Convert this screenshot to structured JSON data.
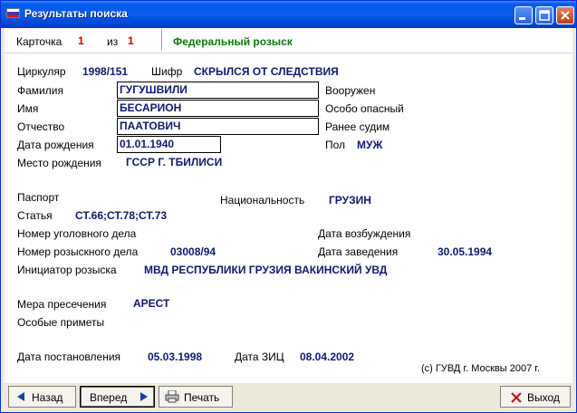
{
  "window": {
    "title": "Результаты поиска"
  },
  "header": {
    "card_label": "Карточка",
    "card_num": "1",
    "of_label": "из",
    "of_num": "1",
    "search_type": "Федеральный розыск"
  },
  "record": {
    "circular_label": "Циркуляр",
    "circular": "1998/151",
    "cipher_label": "Шифр",
    "cipher": "СКРЫЛСЯ ОТ СЛЕДСТВИЯ",
    "surname_label": "Фамилия",
    "surname": "ГУГУШВИЛИ",
    "name_label": "Имя",
    "name": "БЕСАРИОН",
    "patronymic_label": "Отчество",
    "patronymic": "ПААТОВИЧ",
    "birth_date_label": "Дата рождения",
    "birth_date": "01.01.1940",
    "birth_place_label": "Место рождения",
    "birth_place": "ГССР Г. ТБИЛИСИ",
    "armed_label": "Вооружен",
    "dangerous_label": "Особо опасный",
    "convicted_label": "Ранее судим",
    "sex_label": "Пол",
    "sex": "МУЖ",
    "passport_label": "Паспорт",
    "nationality_label": "Национальность",
    "nationality": "ГРУЗИН",
    "article_label": "Статья",
    "article": "СТ.66;СТ.78;СТ.73",
    "criminal_case_label": "Номер уголовного дела",
    "initiation_date_label": "Дата возбуждения",
    "search_case_label": "Номер розыскного дела",
    "search_case": "03008/94",
    "opening_date_label": "Дата заведения",
    "opening_date": "30.05.1994",
    "initiator_label": "Инициатор розыска",
    "initiator": "МВД РЕСПУБЛИКИ ГРУЗИЯ ВАКИНСКИЙ УВД",
    "measure_label": "Мера пресечения",
    "measure": "АРЕСТ",
    "features_label": "Особые приметы",
    "resolution_date_label": "Дата постановления",
    "resolution_date": "05.03.1998",
    "zic_date_label": "Дата ЗИЦ",
    "zic_date": "08.04.2002",
    "copyright": "(с) ГУВД г. Москвы 2007 г."
  },
  "buttons": {
    "back": "Назад",
    "forward": "Вперед",
    "print": "Печать",
    "exit": "Выход"
  },
  "colors": {
    "value_text": "#0d1a6e",
    "counter": "#d00000",
    "search_type": "#0b7a0b",
    "titlebar": "#0058ee"
  }
}
